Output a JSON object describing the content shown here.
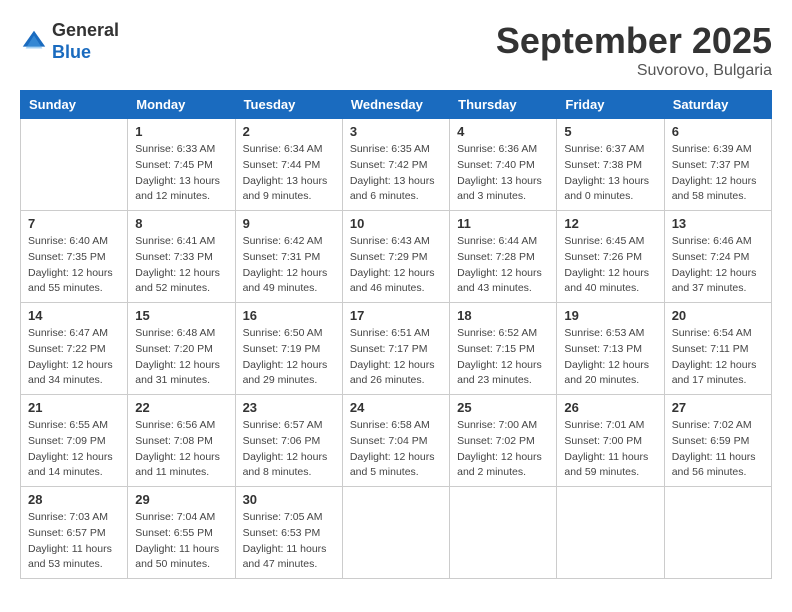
{
  "header": {
    "logo_general": "General",
    "logo_blue": "Blue",
    "month_title": "September 2025",
    "location": "Suvorovo, Bulgaria"
  },
  "weekdays": [
    "Sunday",
    "Monday",
    "Tuesday",
    "Wednesday",
    "Thursday",
    "Friday",
    "Saturday"
  ],
  "weeks": [
    [
      {
        "day": "",
        "info": ""
      },
      {
        "day": "1",
        "info": "Sunrise: 6:33 AM\nSunset: 7:45 PM\nDaylight: 13 hours\nand 12 minutes."
      },
      {
        "day": "2",
        "info": "Sunrise: 6:34 AM\nSunset: 7:44 PM\nDaylight: 13 hours\nand 9 minutes."
      },
      {
        "day": "3",
        "info": "Sunrise: 6:35 AM\nSunset: 7:42 PM\nDaylight: 13 hours\nand 6 minutes."
      },
      {
        "day": "4",
        "info": "Sunrise: 6:36 AM\nSunset: 7:40 PM\nDaylight: 13 hours\nand 3 minutes."
      },
      {
        "day": "5",
        "info": "Sunrise: 6:37 AM\nSunset: 7:38 PM\nDaylight: 13 hours\nand 0 minutes."
      },
      {
        "day": "6",
        "info": "Sunrise: 6:39 AM\nSunset: 7:37 PM\nDaylight: 12 hours\nand 58 minutes."
      }
    ],
    [
      {
        "day": "7",
        "info": "Sunrise: 6:40 AM\nSunset: 7:35 PM\nDaylight: 12 hours\nand 55 minutes."
      },
      {
        "day": "8",
        "info": "Sunrise: 6:41 AM\nSunset: 7:33 PM\nDaylight: 12 hours\nand 52 minutes."
      },
      {
        "day": "9",
        "info": "Sunrise: 6:42 AM\nSunset: 7:31 PM\nDaylight: 12 hours\nand 49 minutes."
      },
      {
        "day": "10",
        "info": "Sunrise: 6:43 AM\nSunset: 7:29 PM\nDaylight: 12 hours\nand 46 minutes."
      },
      {
        "day": "11",
        "info": "Sunrise: 6:44 AM\nSunset: 7:28 PM\nDaylight: 12 hours\nand 43 minutes."
      },
      {
        "day": "12",
        "info": "Sunrise: 6:45 AM\nSunset: 7:26 PM\nDaylight: 12 hours\nand 40 minutes."
      },
      {
        "day": "13",
        "info": "Sunrise: 6:46 AM\nSunset: 7:24 PM\nDaylight: 12 hours\nand 37 minutes."
      }
    ],
    [
      {
        "day": "14",
        "info": "Sunrise: 6:47 AM\nSunset: 7:22 PM\nDaylight: 12 hours\nand 34 minutes."
      },
      {
        "day": "15",
        "info": "Sunrise: 6:48 AM\nSunset: 7:20 PM\nDaylight: 12 hours\nand 31 minutes."
      },
      {
        "day": "16",
        "info": "Sunrise: 6:50 AM\nSunset: 7:19 PM\nDaylight: 12 hours\nand 29 minutes."
      },
      {
        "day": "17",
        "info": "Sunrise: 6:51 AM\nSunset: 7:17 PM\nDaylight: 12 hours\nand 26 minutes."
      },
      {
        "day": "18",
        "info": "Sunrise: 6:52 AM\nSunset: 7:15 PM\nDaylight: 12 hours\nand 23 minutes."
      },
      {
        "day": "19",
        "info": "Sunrise: 6:53 AM\nSunset: 7:13 PM\nDaylight: 12 hours\nand 20 minutes."
      },
      {
        "day": "20",
        "info": "Sunrise: 6:54 AM\nSunset: 7:11 PM\nDaylight: 12 hours\nand 17 minutes."
      }
    ],
    [
      {
        "day": "21",
        "info": "Sunrise: 6:55 AM\nSunset: 7:09 PM\nDaylight: 12 hours\nand 14 minutes."
      },
      {
        "day": "22",
        "info": "Sunrise: 6:56 AM\nSunset: 7:08 PM\nDaylight: 12 hours\nand 11 minutes."
      },
      {
        "day": "23",
        "info": "Sunrise: 6:57 AM\nSunset: 7:06 PM\nDaylight: 12 hours\nand 8 minutes."
      },
      {
        "day": "24",
        "info": "Sunrise: 6:58 AM\nSunset: 7:04 PM\nDaylight: 12 hours\nand 5 minutes."
      },
      {
        "day": "25",
        "info": "Sunrise: 7:00 AM\nSunset: 7:02 PM\nDaylight: 12 hours\nand 2 minutes."
      },
      {
        "day": "26",
        "info": "Sunrise: 7:01 AM\nSunset: 7:00 PM\nDaylight: 11 hours\nand 59 minutes."
      },
      {
        "day": "27",
        "info": "Sunrise: 7:02 AM\nSunset: 6:59 PM\nDaylight: 11 hours\nand 56 minutes."
      }
    ],
    [
      {
        "day": "28",
        "info": "Sunrise: 7:03 AM\nSunset: 6:57 PM\nDaylight: 11 hours\nand 53 minutes."
      },
      {
        "day": "29",
        "info": "Sunrise: 7:04 AM\nSunset: 6:55 PM\nDaylight: 11 hours\nand 50 minutes."
      },
      {
        "day": "30",
        "info": "Sunrise: 7:05 AM\nSunset: 6:53 PM\nDaylight: 11 hours\nand 47 minutes."
      },
      {
        "day": "",
        "info": ""
      },
      {
        "day": "",
        "info": ""
      },
      {
        "day": "",
        "info": ""
      },
      {
        "day": "",
        "info": ""
      }
    ]
  ]
}
